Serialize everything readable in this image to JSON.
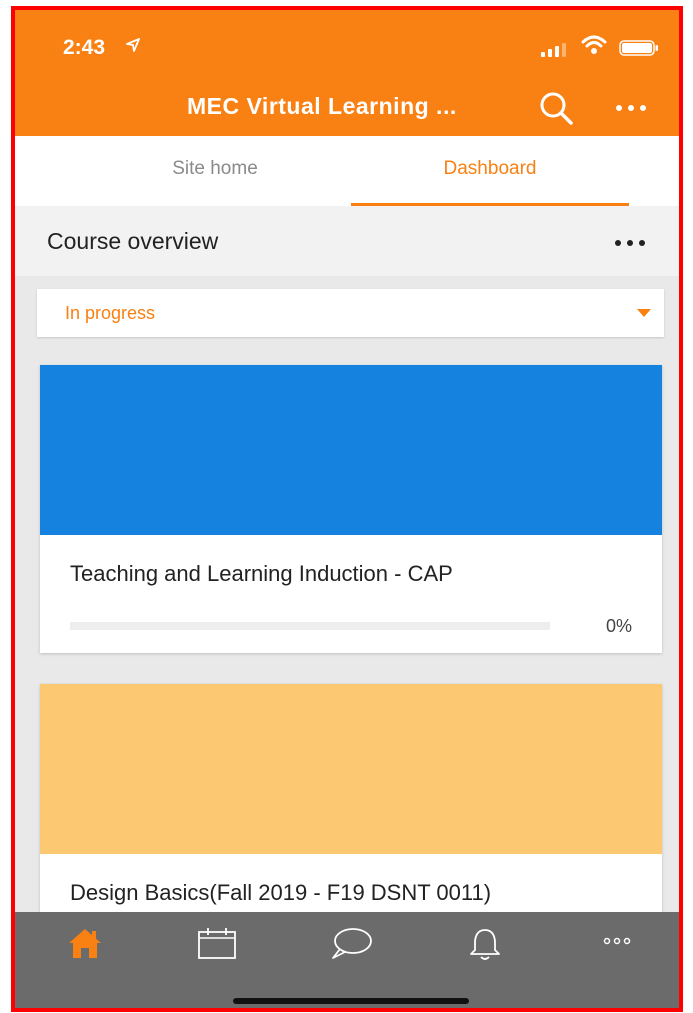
{
  "status_bar": {
    "time": "2:43"
  },
  "app_bar": {
    "title": "MEC Virtual Learning ..."
  },
  "tabs": [
    {
      "label": "Site home",
      "active": false
    },
    {
      "label": "Dashboard",
      "active": true
    }
  ],
  "section": {
    "title": "Course overview"
  },
  "filter": {
    "selected": "In progress"
  },
  "courses": [
    {
      "title": "Teaching and Learning Induction - CAP",
      "image_color": "#1582e0",
      "progress_percent": 0,
      "progress_text": "0%"
    },
    {
      "title": "Design Basics(Fall 2019 - F19 DSNT 0011)",
      "image_color": "#fcc972"
    }
  ],
  "bottom_nav": [
    {
      "icon": "home-icon",
      "active": true
    },
    {
      "icon": "calendar-icon",
      "active": false
    },
    {
      "icon": "messages-icon",
      "active": false
    },
    {
      "icon": "bell-icon",
      "active": false
    },
    {
      "icon": "more-icon",
      "active": false
    }
  ],
  "colors": {
    "brand": "#f98012",
    "nav_bg": "#6b6b6b",
    "nav_active": "#f98012",
    "nav_inactive": "#ffffff"
  }
}
